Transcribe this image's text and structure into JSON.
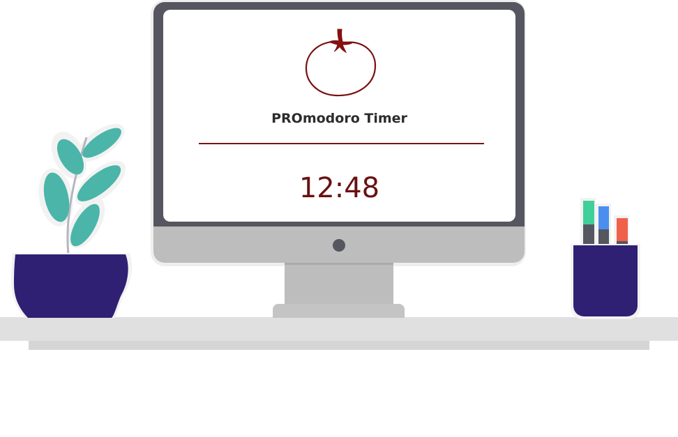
{
  "app": {
    "title": "PROmodoro Timer",
    "timer_display": "12:48"
  },
  "icons": {
    "logo": "tomato-icon"
  },
  "colors": {
    "accent": "#7a1414",
    "timer_text": "#6a1010",
    "monitor_frame": "#565660",
    "pot": "#2f2074",
    "leaf": "#4ab5a8",
    "marker_green": "#3fcf9b",
    "marker_blue": "#4b8ef0",
    "marker_red": "#f0604a"
  }
}
